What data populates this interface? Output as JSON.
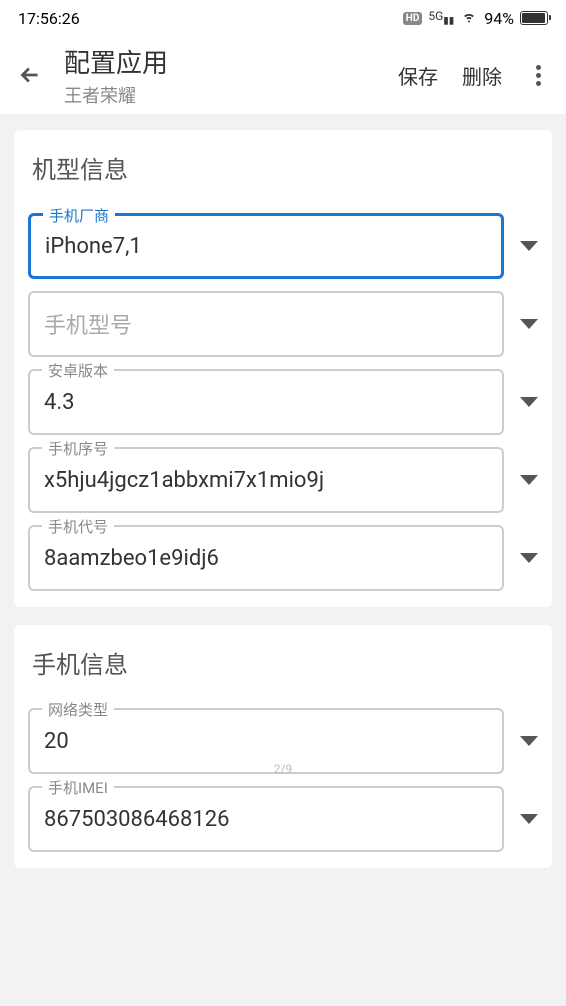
{
  "status_bar": {
    "time": "17:56:26",
    "hd_badge": "HD",
    "network": "5G",
    "battery_percent": "94%"
  },
  "header": {
    "title": "配置应用",
    "subtitle": "王者荣耀",
    "save_label": "保存",
    "delete_label": "删除"
  },
  "section1": {
    "title": "机型信息",
    "fields": {
      "manufacturer": {
        "label": "手机厂商",
        "value": "iPhone7,1"
      },
      "model": {
        "label": "手机型号",
        "value": ""
      },
      "android_version": {
        "label": "安卓版本",
        "value": "4.3"
      },
      "serial": {
        "label": "手机序号",
        "value": "x5hju4jgcz1abbxmi7x1mio9j"
      },
      "codename": {
        "label": "手机代号",
        "value": "8aamzbeo1e9idj6"
      }
    }
  },
  "section2": {
    "title": "手机信息",
    "fields": {
      "network_type": {
        "label": "网络类型",
        "value": "20"
      },
      "imei": {
        "label": "手机IMEI",
        "value": "867503086468126"
      }
    }
  },
  "page_indicator": "2/9"
}
